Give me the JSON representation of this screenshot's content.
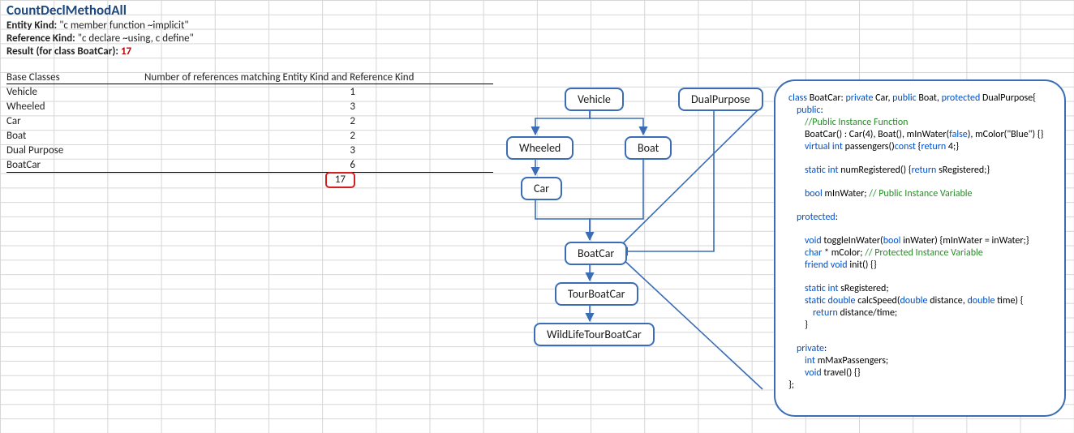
{
  "title": "CountDeclMethodAll",
  "meta": {
    "entity_kind_label": "Entity Kind:",
    "entity_kind_value": "\"c member function ~implicit\"",
    "reference_kind_label": "Reference Kind:",
    "reference_kind_value": "\"c declare ~using, c define\"",
    "result_label": "Result  (for class BoatCar):",
    "result_value": "17"
  },
  "table": {
    "headers": {
      "col1": "Base Classes",
      "col2": "Number of references matching Entity Kind and Reference Kind"
    },
    "rows": [
      {
        "name": "Vehicle",
        "count": "1"
      },
      {
        "name": "Wheeled",
        "count": "3"
      },
      {
        "name": "Car",
        "count": "2"
      },
      {
        "name": "Boat",
        "count": "2"
      },
      {
        "name": "Dual Purpose",
        "count": "3"
      },
      {
        "name": "BoatCar",
        "count": "6"
      }
    ],
    "total": "17"
  },
  "diagram": {
    "vehicle": "Vehicle",
    "dualpurpose": "DualPurpose",
    "wheeled": "Wheeled",
    "boat": "Boat",
    "car": "Car",
    "boatcar": "BoatCar",
    "tourboatcar": "TourBoatCar",
    "wildlife": "WildLifeTourBoatCar"
  },
  "chart_data": {
    "type": "diagram-hierarchy",
    "nodes": [
      "Vehicle",
      "DualPurpose",
      "Wheeled",
      "Boat",
      "Car",
      "BoatCar",
      "TourBoatCar",
      "WildLifeTourBoatCar"
    ],
    "edges": [
      [
        "Vehicle",
        "Wheeled"
      ],
      [
        "Vehicle",
        "Boat"
      ],
      [
        "Wheeled",
        "Car"
      ],
      [
        "Car",
        "BoatCar"
      ],
      [
        "Boat",
        "BoatCar"
      ],
      [
        "DualPurpose",
        "BoatCar"
      ],
      [
        "BoatCar",
        "TourBoatCar"
      ],
      [
        "TourBoatCar",
        "WildLifeTourBoatCar"
      ]
    ],
    "callout_from": "BoatCar",
    "callout_to": "code-panel"
  },
  "code": {
    "l1a": "class ",
    "l1b": "BoatCar: ",
    "l1c": "private ",
    "l1d": "Car, ",
    "l1e": "public ",
    "l1f": "Boat, ",
    "l1g": "protected ",
    "l1h": "DualPurpose{",
    "l2": "public",
    "l3": "//Public Instance Function",
    "l4a": "BoatCar() : Car(4), Boat(), mInWater(",
    "l4b": "false",
    "l4c": "), mColor(\"Blue\") {}",
    "l5a": "virtual int ",
    "l5b": "passengers()",
    "l5c": "const ",
    "l5d": "{",
    "l5e": "return ",
    "l5f": "4;}",
    "l6a": "static int ",
    "l6b": "numRegistered() {",
    "l6c": "return ",
    "l6d": "sRegistered;}",
    "l7a": "bool ",
    "l7b": "mInWater; ",
    "l7c": "// Public Instance Variable",
    "l8": "protected",
    "l9a": "void ",
    "l9b": "toggleInWater(",
    "l9c": "bool ",
    "l9d": "inWater) {mInWater = inWater;}",
    "l10a": "char ",
    "l10b": "* mColor; ",
    "l10c": "// Protected Instance Variable",
    "l11a": "friend void ",
    "l11b": "init() {}",
    "l12a": "static int ",
    "l12b": "sRegistered;",
    "l13a": "static double ",
    "l13b": "calcSpeed(",
    "l13c": "double ",
    "l13d": "distance, ",
    "l13e": "double ",
    "l13f": "time) {",
    "l14a": "return ",
    "l14b": "distance/time;",
    "l15": "}",
    "l16": "private",
    "l17a": "int ",
    "l17b": "mMaxPassengers;",
    "l18a": "void ",
    "l18b": "travel() {}",
    "l19": "};"
  }
}
